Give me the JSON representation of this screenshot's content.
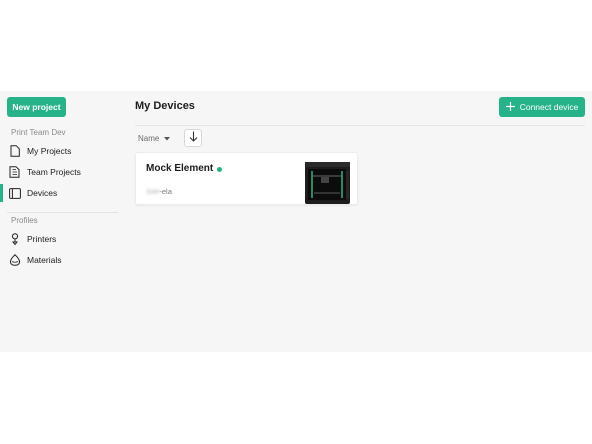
{
  "sidebar": {
    "new_project_label": "New project",
    "group_label": "Print Team Dev",
    "items": [
      {
        "label": "My Projects",
        "icon": "document-icon"
      },
      {
        "label": "Team Projects",
        "icon": "documents-icon"
      },
      {
        "label": "Devices",
        "icon": "device-icon",
        "active": true
      }
    ],
    "profiles_label": "Profiles",
    "profile_items": [
      {
        "label": "Printers",
        "icon": "nozzle-icon"
      },
      {
        "label": "Materials",
        "icon": "spool-icon"
      }
    ]
  },
  "main": {
    "title": "My Devices",
    "connect_label": "Connect device",
    "sort_label": "Name",
    "device": {
      "name": "Mock Element",
      "subtitle_prefix": "S##",
      "subtitle_suffix": "-ela",
      "status": "online"
    }
  },
  "colors": {
    "accent": "#27b38a",
    "background": "#f6f6f6"
  }
}
